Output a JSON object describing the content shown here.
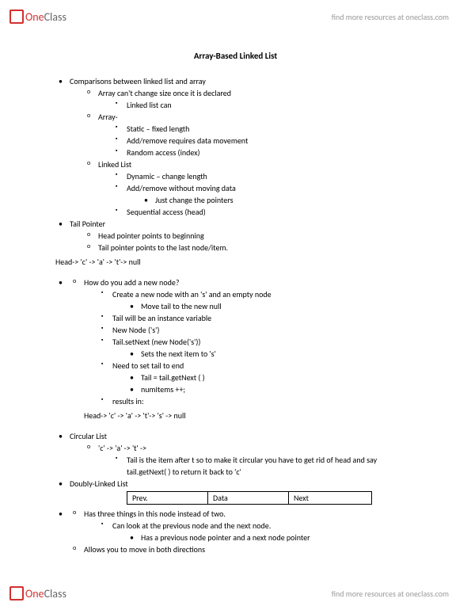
{
  "brand": {
    "one": "One",
    "class": "Class",
    "tagline": "find more resources at oneclass.com"
  },
  "title": "Array-Based Linked List",
  "s1": {
    "h": "Comparisons between linked list and array",
    "a": "Array can't change size once it is declared",
    "a1": "Linked list can",
    "b": "Array-",
    "b1": "Static – fixed length",
    "b2": "Add/remove requires data movement",
    "b3": "Random access (index)",
    "c": "Linked List",
    "c1": "Dynamic – change length",
    "c2": "Add/remove without moving data",
    "c2a": "Just change the pointers",
    "c3": "Sequential access (head)"
  },
  "s2": {
    "h": "Tail Pointer",
    "a": "Head pointer points to beginning",
    "b": "Tail pointer points to the last node/item."
  },
  "diagram1": "Head-> 'c' -> 'a' -> 't'-> null",
  "s3": {
    "a": "How do you add a new node?",
    "a1": "Create a new node with an 's' and an empty node",
    "a1a": "Move tail to the new null",
    "a2": "Tail will be an instance variable",
    "a3": "New Node ('s')",
    "a4": "Tail.setNext (new Node('s'))",
    "a4a": "Sets the next item to 's'",
    "a5": "Need to set tail to end",
    "a5a": "Tail = tail.getNext ( )",
    "a5b": "numItems ++;",
    "a6": "results in:"
  },
  "diagram2": "Head-> 'c' -> 'a' -> 't'-> 's' -> null",
  "s4": {
    "h": "Circular List",
    "a": "'c' -> 'a' -> 't' ->",
    "a1": "Tail is the item after t so to make it circular you have to get rid of head and say tail.getNext( ) to return it back to 'c'"
  },
  "s5": {
    "h": "Doubly-Linked List",
    "table": {
      "c1": "Prev.",
      "c2": "Data",
      "c3": "Next"
    },
    "a": "Has three things in this node instead of two.",
    "a1": "Can look at the previous node and the next node.",
    "a1a": "Has a previous node pointer and a next node pointer",
    "b": "Allows you to move in both directions"
  }
}
